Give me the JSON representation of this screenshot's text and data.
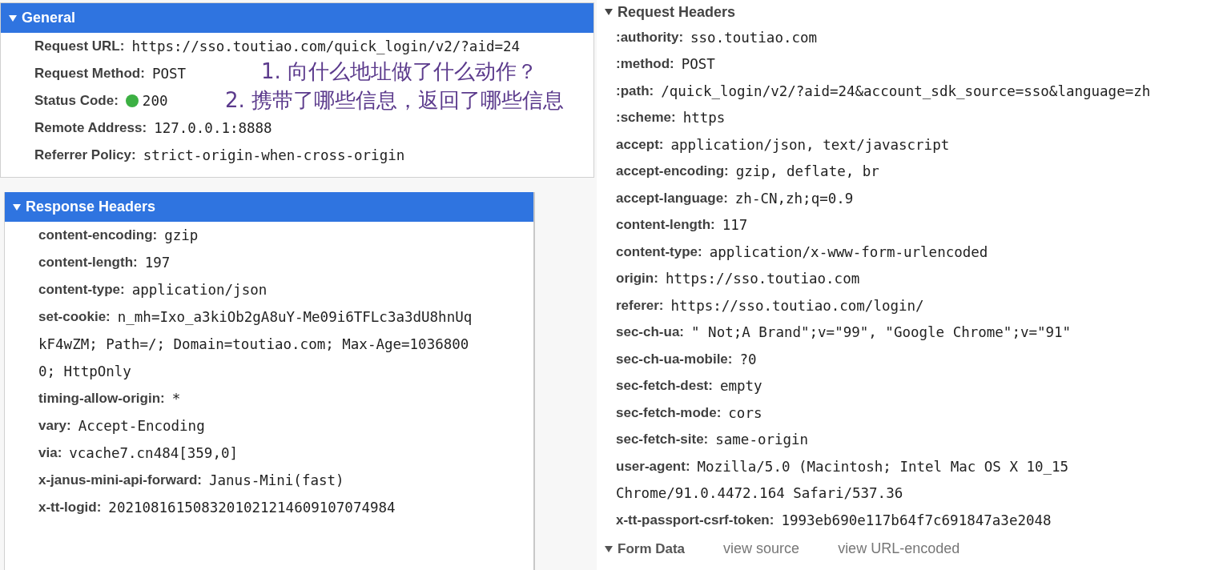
{
  "general": {
    "title": "General",
    "expanded": true,
    "selected": true,
    "rows": [
      {
        "name": "Request URL:",
        "value": "https://sso.toutiao.com/quick_login/v2/?aid=24"
      },
      {
        "name": "Request Method:",
        "value": "POST"
      },
      {
        "name": "Status Code:",
        "value": "200",
        "color": "#3cb043"
      },
      {
        "name": "Remote Address:",
        "value": "127.0.0.1:8888"
      },
      {
        "name": "Referrer Policy:",
        "value": "strict-origin-when-cross-origin"
      }
    ]
  },
  "annotations": [
    "1. 向什么地址做了什么动作？",
    "2. 携带了哪些信息，返回了哪些信息"
  ],
  "response_headers": {
    "title": "Response Headers",
    "expanded": true,
    "selected": true,
    "rows": [
      {
        "name": "content-encoding:",
        "value": "gzip"
      },
      {
        "name": "content-length:",
        "value": "197"
      },
      {
        "name": "content-type:",
        "value": "application/json"
      },
      {
        "name": "set-cookie:",
        "value": "n_mh=Ixo_a3kiOb2gA8uY-Me09i6TFLc3a3dU8hnUq",
        "continued": [
          "kF4wZM; Path=/; Domain=toutiao.com; Max-Age=1036800",
          "0; HttpOnly"
        ]
      },
      {
        "name": "timing-allow-origin:",
        "value": "*"
      },
      {
        "name": "vary:",
        "value": "Accept-Encoding"
      },
      {
        "name": "via:",
        "value": "vcache7.cn484[359,0]"
      },
      {
        "name": "x-janus-mini-api-forward:",
        "value": "Janus-Mini(fast)"
      },
      {
        "name": "x-tt-logid:",
        "value": "2021081615083201021214609107074984"
      }
    ]
  },
  "request_headers": {
    "title": "Request Headers",
    "expanded": true,
    "selected": false,
    "rows": [
      {
        "name": ":authority:",
        "value": "sso.toutiao.com"
      },
      {
        "name": ":method:",
        "value": "POST"
      },
      {
        "name": ":path:",
        "value": "/quick_login/v2/?aid=24&account_sdk_source=sso&language=zh"
      },
      {
        "name": ":scheme:",
        "value": "https"
      },
      {
        "name": "accept:",
        "value": "application/json, text/javascript"
      },
      {
        "name": "accept-encoding:",
        "value": "gzip, deflate, br"
      },
      {
        "name": "accept-language:",
        "value": "zh-CN,zh;q=0.9"
      },
      {
        "name": "content-length:",
        "value": "117"
      },
      {
        "name": "content-type:",
        "value": "application/x-www-form-urlencoded"
      },
      {
        "name": "origin:",
        "value": "https://sso.toutiao.com"
      },
      {
        "name": "referer:",
        "value": "https://sso.toutiao.com/login/"
      },
      {
        "name": "sec-ch-ua:",
        "value": "\" Not;A Brand\";v=\"99\", \"Google Chrome\";v=\"91\""
      },
      {
        "name": "sec-ch-ua-mobile:",
        "value": "?0"
      },
      {
        "name": "sec-fetch-dest:",
        "value": "empty"
      },
      {
        "name": "sec-fetch-mode:",
        "value": "cors"
      },
      {
        "name": "sec-fetch-site:",
        "value": "same-origin"
      },
      {
        "name": "user-agent:",
        "value": "Mozilla/5.0 (Macintosh; Intel Mac OS X 10_15",
        "continued": [
          "Chrome/91.0.4472.164 Safari/537.36"
        ]
      },
      {
        "name": "x-tt-passport-csrf-token:",
        "value": "1993eb690e117b64f7c691847a3e2048"
      }
    ]
  },
  "form_data": {
    "title": "Form Data",
    "expanded": true,
    "selected": false,
    "links": [
      "view source",
      "view URL-encoded"
    ]
  }
}
